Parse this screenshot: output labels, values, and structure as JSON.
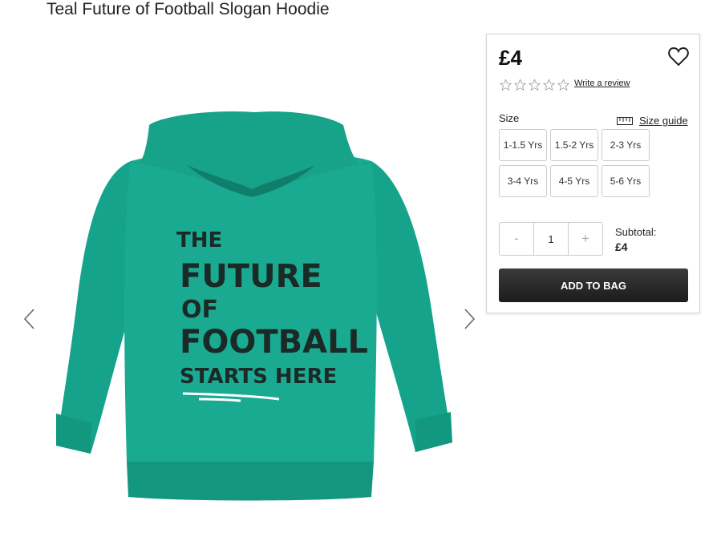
{
  "product": {
    "title": "Teal Future of Football Slogan Hoodie"
  },
  "hoodie_print": {
    "line1": "THE",
    "line2": "FUTURE",
    "line3": "OF",
    "line4": "FOOTBALL",
    "line5": "STARTS HERE"
  },
  "panel": {
    "price": "£4",
    "rating_stars": 5,
    "write_review": "Write a review",
    "size_label": "Size",
    "size_guide": "Size guide",
    "sizes": [
      "1-1.5 Yrs",
      "1.5-2 Yrs",
      "2-3 Yrs",
      "3-4 Yrs",
      "4-5 Yrs",
      "5-6 Yrs"
    ],
    "quantity": {
      "minus": "-",
      "value": "1",
      "plus": "+"
    },
    "subtotal_label": "Subtotal:",
    "subtotal_value": "£4",
    "add_to_bag": "ADD TO BAG"
  },
  "colors": {
    "hoodie_teal": "#1aaa92",
    "button_dark": "#2a2a2a"
  },
  "icons": {
    "prev": "chevron-left-icon",
    "next": "chevron-right-icon",
    "wishlist": "heart-icon",
    "size_guide": "ruler-icon",
    "star": "star-outline-icon"
  }
}
